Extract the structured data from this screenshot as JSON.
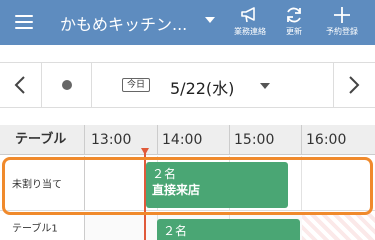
{
  "header": {
    "store_name": "かもめキッチン...",
    "notice_label": "業務連絡",
    "refresh_label": "更新",
    "reserve_label": "予約登録"
  },
  "datebar": {
    "today_label": "今日",
    "date": "5/22(水)"
  },
  "timeline": {
    "column_label": "テーブル",
    "hours": [
      "13:00",
      "14:00",
      "15:00",
      "16:00"
    ],
    "rows": [
      {
        "label": "未割り当て"
      },
      {
        "label": "テーブル1"
      }
    ],
    "reservations": [
      {
        "count": "２名",
        "type": "直接来店"
      },
      {
        "count": "２名",
        "type": ""
      }
    ]
  },
  "colors": {
    "header_bg": "#5e8cbf",
    "reservation_green": "#4aa674",
    "now_line": "#e05a3a",
    "highlight_orange": "#f08a2c"
  }
}
